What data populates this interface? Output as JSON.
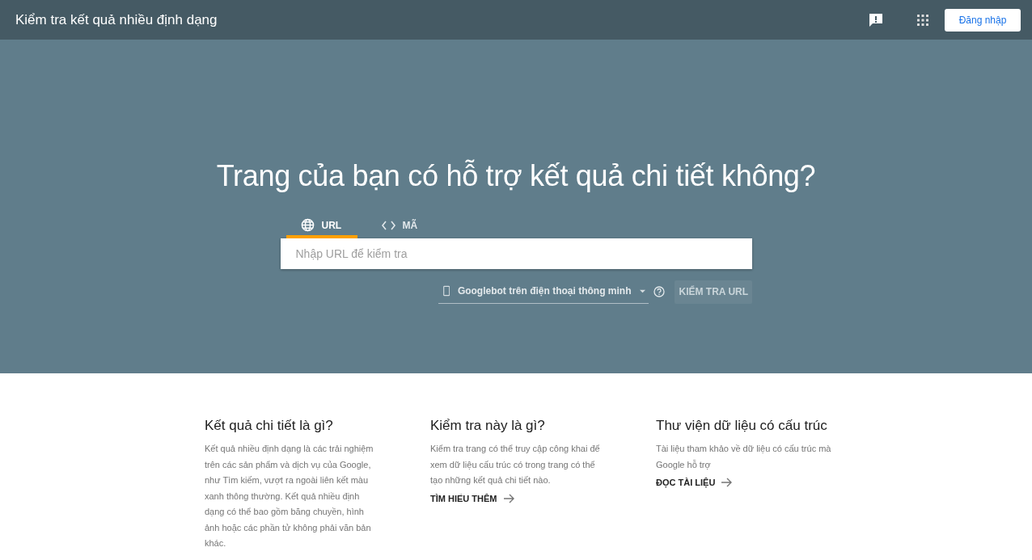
{
  "header": {
    "title": "Kiểm tra kết quả nhiều định dạng",
    "signin_button": "Đăng nhập"
  },
  "hero": {
    "heading": "Trang của bạn có hỗ trợ kết quả chi tiết không?",
    "tabs": [
      {
        "label": "URL",
        "kind": "globe",
        "selected": true
      },
      {
        "label": "MÃ",
        "kind": "code",
        "selected": false
      }
    ],
    "url_field": {
      "placeholder": "Nhập URL để kiểm tra"
    },
    "agent_dropdown": {
      "value": "Googlebot trên điện thoại thông minh"
    },
    "test_button": {
      "label": "KIỂM TRA URL",
      "disabled": true
    }
  },
  "cards": [
    {
      "heading": "Kết quả chi tiết là gì?",
      "body": "Kết quả nhiều định dạng là các trải nghiệm trên các sản phẩm và dịch vụ của Google, như Tìm kiếm, vượt ra ngoài liên kết màu xanh thông thường. Kết quả nhiều định dạng có thể bao gồm băng chuyền, hình ảnh hoặc các phần tử không phải văn bản khác."
    },
    {
      "heading": "Kiểm tra này là gì?",
      "body": "Kiểm tra trang có thể truy cập công khai để xem dữ liệu cấu trúc có trong trang có thể tạo những kết quả chi tiết nào.",
      "link": "TÌM HIỂU THÊM"
    },
    {
      "heading": "Thư viện dữ liệu có cấu trúc",
      "body": "Tài liệu tham khảo về dữ liệu có cấu trúc mà Google hỗ trợ",
      "link": "ĐỌC TÀI LIỆU"
    }
  ]
}
